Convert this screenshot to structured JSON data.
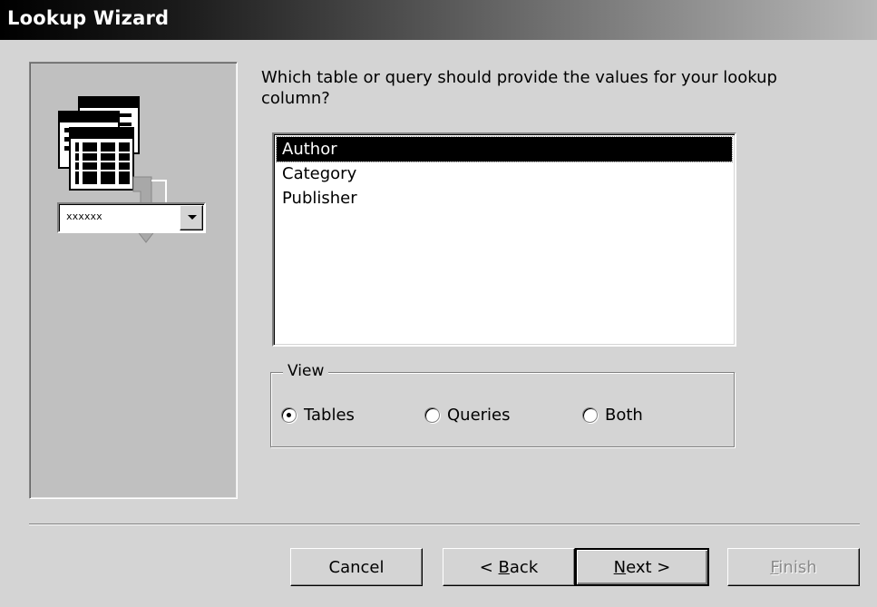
{
  "window": {
    "title": "Lookup Wizard"
  },
  "illustration": {
    "combo_text": "xxxxxx"
  },
  "prompt": "Which table or query should provide the values for your lookup column?",
  "list": {
    "items": [
      "Author",
      "Category",
      "Publisher"
    ],
    "selected_index": 0
  },
  "view_group": {
    "legend": "View",
    "options": [
      {
        "label": "Tables",
        "checked": true
      },
      {
        "label": "Queries",
        "checked": false
      },
      {
        "label": "Both",
        "checked": false
      }
    ]
  },
  "buttons": {
    "cancel": "Cancel",
    "back_prefix": "< ",
    "back_mnemonic": "B",
    "back_rest": "ack",
    "next_mnemonic": "N",
    "next_rest": "ext >",
    "finish_mnemonic": "F",
    "finish_rest": "inish"
  }
}
